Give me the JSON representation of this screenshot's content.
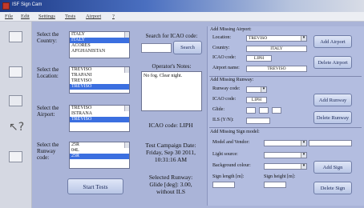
{
  "app": {
    "title": "ISF Sign Cam"
  },
  "menu": [
    "File",
    "Edit",
    "Settings",
    "Tests",
    "Airport",
    "?"
  ],
  "country": {
    "label": "Select the Country:",
    "items": [
      "ITALY",
      "ITALY",
      "ACORES",
      "AFGHANISTAN"
    ],
    "selected": 1
  },
  "location": {
    "label": "Select the Location:",
    "items": [
      "TREVISO",
      "TRAPANI",
      "TREVISO",
      "TREVISO"
    ],
    "selected": 3
  },
  "airport": {
    "label": "Select the Airport:",
    "items": [
      "TREVISO",
      "ISTRANA",
      "TREVISO"
    ],
    "selected": 2
  },
  "runway": {
    "label": "Select the Runway code:",
    "items": [
      "25R",
      "04L",
      "25R"
    ],
    "selected": 2
  },
  "start_button": "Start Tests",
  "search": {
    "label": "Search for ICAO code:",
    "value": "",
    "button": "Search"
  },
  "notes": {
    "label": "Operator's Notes:",
    "value": "No fog. Clear night."
  },
  "icao": {
    "text": "ICAO code:    LIPH"
  },
  "campaign": {
    "line1": "Test Campaign Date:",
    "line2": "Friday, Sep 30 2011,",
    "line3": "10:31:16 AM"
  },
  "runway_info": {
    "line1": "Selected Runway:",
    "line2": "Glide [deg]: 3.00,",
    "line3": "without ILS"
  },
  "add_airport": {
    "section": "Add Missing Airport:",
    "location_label": "Location:",
    "location_value": "TREVISO",
    "country_label": "Country:",
    "country_value": "ITALY",
    "icao_label": "ICAO code:",
    "icao_value": "LIPH",
    "name_label": "Airport name:",
    "name_value": "TREVISO",
    "add_button": "Add Airport",
    "delete_button": "Delete Airport"
  },
  "add_runway": {
    "section": "Add Missing Runway:",
    "runway_label": "Runway code:",
    "runway_value": "",
    "icao_label": "ICAO code:",
    "icao_value": "LIPH",
    "glide_label": "Glide:",
    "ils_label": "ILS (Y/N):",
    "ils_value": "",
    "add_button": "Add Runway",
    "delete_button": "Delete Runway"
  },
  "add_sign": {
    "section": "Add Missing Sign model:",
    "model_label": "Model and Vendor:",
    "light_label": "Light source:",
    "bg_label": "Background colour:",
    "length_label": "Sign length [m]:",
    "height_label": "Sign height [m]:",
    "add_button": "Add Sign",
    "delete_button": "Delete Sign"
  },
  "colors": {
    "panel": "#aab4d8",
    "selection": "#3b6fe0",
    "titlebar": "#1d3a86"
  }
}
